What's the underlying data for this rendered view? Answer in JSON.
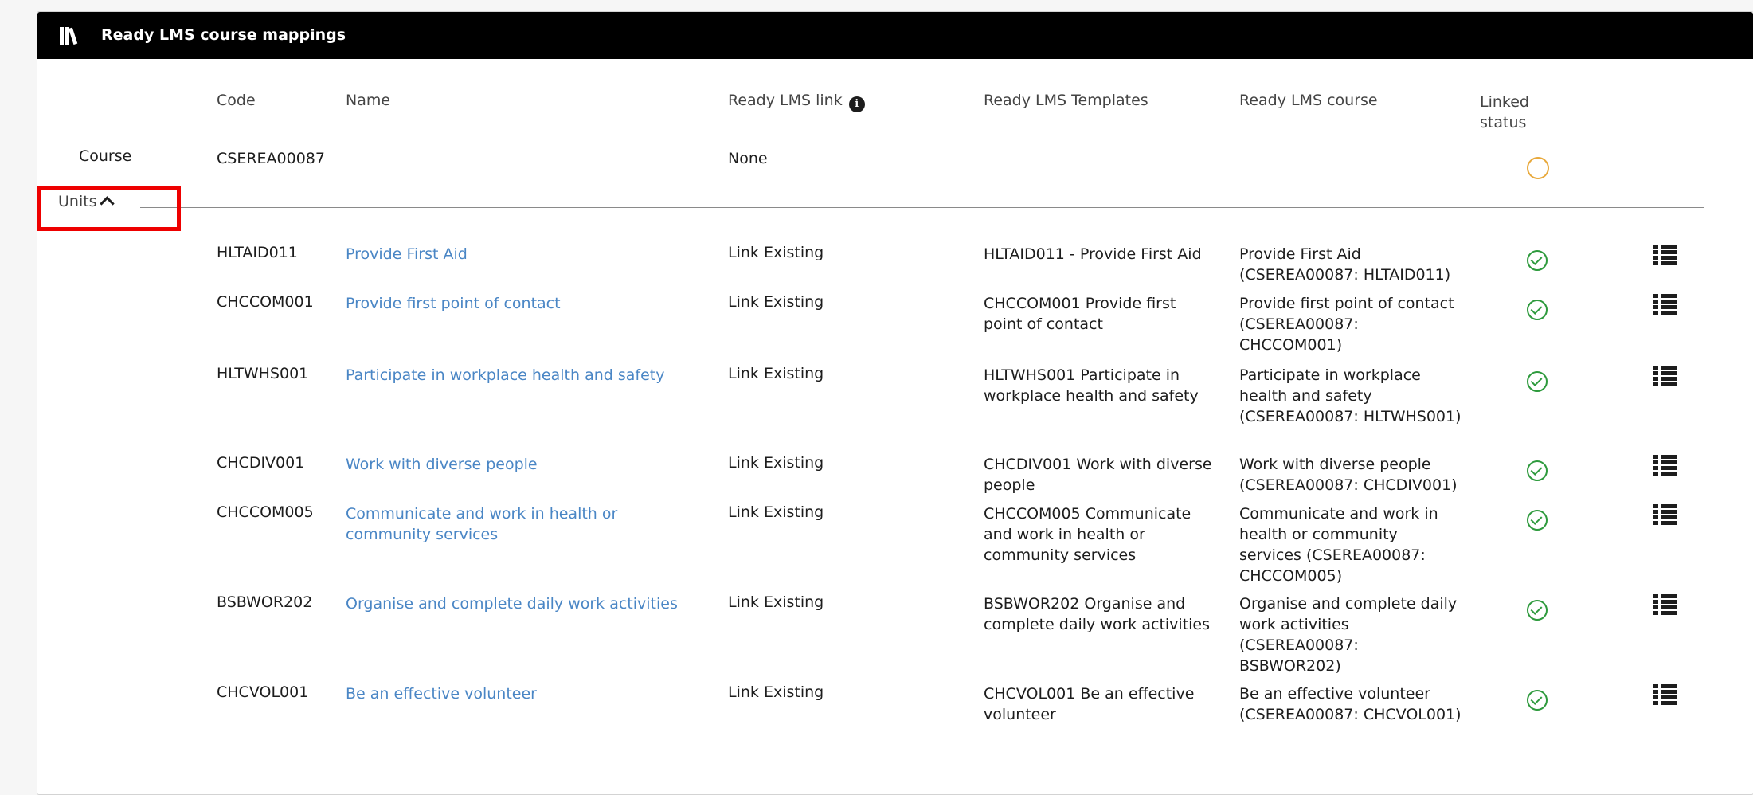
{
  "panel": {
    "title": "Ready LMS course mappings",
    "icon": "books-icon"
  },
  "columns": {
    "code": "Code",
    "name": "Name",
    "link": "Ready LMS link",
    "templates": "Ready LMS Templates",
    "course": "Ready LMS course",
    "status_line1": "Linked",
    "status_line2": "status"
  },
  "course_row": {
    "label": "Course",
    "code": "CSEREA00087",
    "link": "None",
    "status": "unlinked"
  },
  "units_toggle": {
    "label": "Units"
  },
  "units": [
    {
      "code": "HLTAID011",
      "name": "Provide First Aid",
      "link": "Link Existing",
      "template": "HLTAID011 - Provide First Aid",
      "course": "Provide First Aid (CSEREA00087: HLTAID011)",
      "status": "linked"
    },
    {
      "code": "CHCCOM001",
      "name": "Provide first point of contact",
      "link": "Link Existing",
      "template": "CHCCOM001 Provide first point of contact",
      "course": "Provide first point of contact (CSEREA00087: CHCCOM001)",
      "status": "linked"
    },
    {
      "code": "HLTWHS001",
      "name": "Participate in workplace health and safety",
      "link": "Link Existing",
      "template": "HLTWHS001 Participate in workplace health and safety",
      "course": "Participate in workplace health and safety (CSEREA00087: HLTWHS001)",
      "status": "linked"
    },
    {
      "code": "CHCDIV001",
      "name": "Work with diverse people",
      "link": "Link Existing",
      "template": "CHCDIV001 Work with diverse people",
      "course": "Work with diverse people (CSEREA00087: CHCDIV001)",
      "status": "linked"
    },
    {
      "code": "CHCCOM005",
      "name": "Communicate and work in health or community services",
      "link": "Link Existing",
      "template": "CHCCOM005 Communicate and work in health or community services",
      "course": "Communicate and work in health or community services (CSEREA00087: CHCCOM005)",
      "status": "linked"
    },
    {
      "code": "BSBWOR202",
      "name": "Organise and complete daily work activities",
      "link": "Link Existing",
      "template": "BSBWOR202 Organise and complete daily work activities",
      "course": "Organise and complete daily work activities (CSEREA00087: BSBWOR202)",
      "status": "linked"
    },
    {
      "code": "CHCVOL001",
      "name": "Be an effective volunteer",
      "link": "Link Existing",
      "template": "CHCVOL001 Be an effective volunteer",
      "course": "Be an effective volunteer (CSEREA00087: CHCVOL001)",
      "status": "linked"
    }
  ],
  "colors": {
    "header_bg": "#000000",
    "link": "#4a86c5",
    "linked": "#2e9a3d",
    "unlinked": "#e8a93c",
    "highlight": "#ee0000"
  }
}
